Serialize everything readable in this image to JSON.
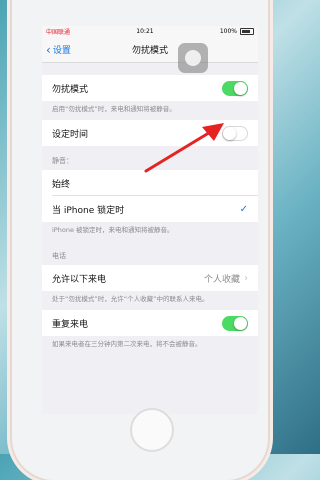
{
  "status": {
    "carrier": "中国联通",
    "time": "10:21",
    "battery": "100%"
  },
  "nav": {
    "back_label": "设置",
    "title": "勿扰模式"
  },
  "dnd": {
    "label": "勿扰模式",
    "footer": "启用“勿扰模式”时，来电和通知将被静音。",
    "scheduled_label": "设定时间"
  },
  "silence": {
    "header": "静音：",
    "always_label": "始终",
    "locked_label": "当 iPhone 锁定时",
    "footer": "iPhone 被锁定时，来电和通知将被静音。"
  },
  "phone": {
    "header": "电话",
    "allow_calls_label": "允许以下来电",
    "allow_calls_value": "个人收藏",
    "allow_footer": "处于“勿扰模式”时，允许“个人收藏”中的联系人来电。",
    "repeated_label": "重复来电",
    "repeated_footer": "如果来电者在三分钟内第二次来电，将不会被静音。"
  },
  "colors": {
    "accent": "#1677e6",
    "toggle_on": "#4cd964",
    "arrow": "#e62323"
  }
}
